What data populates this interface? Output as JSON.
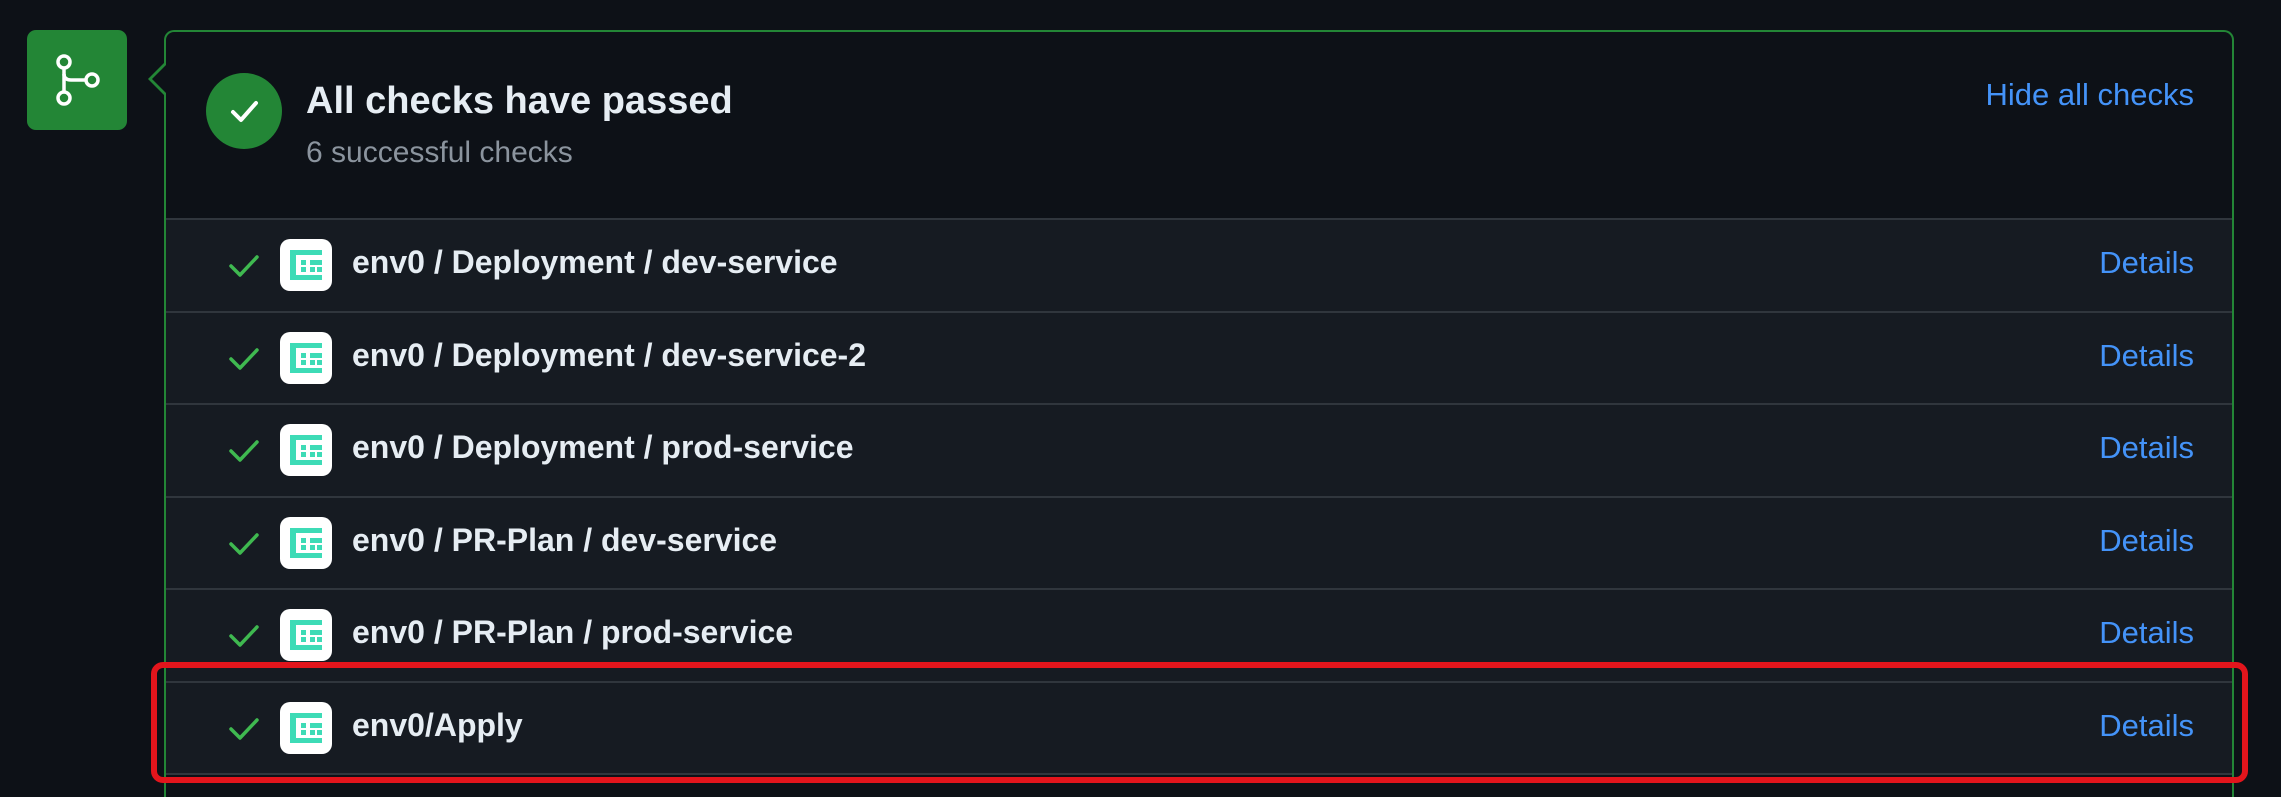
{
  "icons": {
    "merge_badge": "git-branch-icon",
    "summary": "check-circle-icon",
    "row_check": "check-icon",
    "app_logo": "env0-logo-icon"
  },
  "colors": {
    "background": "#0d1117",
    "success_green": "#238636",
    "check_green": "#3fb950",
    "link_blue": "#4493f8",
    "env0_teal": "#3ddbb6",
    "highlight_red": "#e3151c"
  },
  "summary": {
    "title": "All checks have passed",
    "subtitle": "6 successful checks",
    "hide_label": "Hide all checks"
  },
  "checks": [
    {
      "name": "env0 / Deployment / dev-service",
      "details_label": "Details"
    },
    {
      "name": "env0 / Deployment / dev-service-2",
      "details_label": "Details"
    },
    {
      "name": "env0 / Deployment / prod-service",
      "details_label": "Details"
    },
    {
      "name": "env0 / PR-Plan / dev-service",
      "details_label": "Details"
    },
    {
      "name": "env0 / PR-Plan / prod-service",
      "details_label": "Details"
    },
    {
      "name": "env0/Apply",
      "details_label": "Details"
    }
  ]
}
